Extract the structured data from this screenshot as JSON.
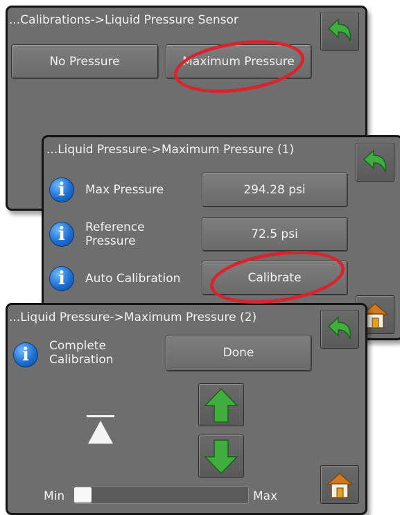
{
  "panel1": {
    "title": "...Calibrations->Liquid Pressure Sensor",
    "no_pressure_label": "No Pressure",
    "max_pressure_label": "Maximum Pressure"
  },
  "panel2": {
    "title": "...Liquid Pressure->Maximum Pressure (1)",
    "rows": [
      {
        "label": "Max Pressure",
        "value": "294.28 psi"
      },
      {
        "label": "Reference Pressure",
        "value": "72.5 psi"
      },
      {
        "label": "Auto Calibration",
        "value": "Calibrate"
      }
    ]
  },
  "panel3": {
    "title": "...Liquid Pressure->Maximum Pressure (2)",
    "complete_label": "Complete Calibration",
    "done_label": "Done",
    "min_label": "Min",
    "max_label": "Max",
    "slider_level_fraction": 0.1
  },
  "icons": {
    "info": "i",
    "back": "back-arrow-icon",
    "home": "home-icon",
    "up": "up-arrow-icon",
    "down": "down-arrow-icon"
  },
  "colors": {
    "panel_bg": "#6e6e6e",
    "highlight": "#d9232d",
    "info_blue": "#1f6fd1",
    "arrow_green": "#3fae3f"
  }
}
